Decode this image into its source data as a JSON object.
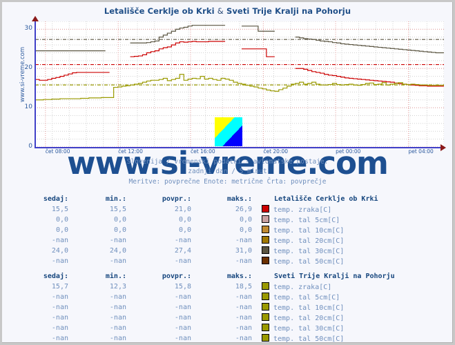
{
  "page": {
    "side_text": "www.si-vreme.com",
    "watermark": "www.si-vreme.com",
    "title": "Letališče Cerklje ob Krki & Sveti Trije Kralji na Pohorju",
    "title_part1": "Letališče Cerklje ob Krki",
    "title_amp": "&",
    "title_part2": "Sveti Trije Kralji na Pohorju",
    "subtitle1": "Slovenija / vremenski podatki - avtomatske postaje.",
    "subtitle2": "zadnji dan / 5 minut",
    "subtitle3": "Meritve: povprečne  Enote: metrične  Črta: povprečje"
  },
  "colors": {
    "accent": "#1f4e87",
    "axis": "#4040c8",
    "arrow": "#8b1a1a",
    "grid_major": "#e8a0a0",
    "grid_minor": "#d8d8d8",
    "label": "#2c5a9e",
    "value": "#6f8fbd",
    "header": "#16467e",
    "background": "#f6f7fc",
    "plot_bg": "#ffffff"
  },
  "chart_data": {
    "type": "line",
    "title": "Letališče Cerklje ob Krki & Sveti Trije Kralji na Pohorju",
    "xlabel": "",
    "ylabel": "",
    "ylim": [
      0,
      32
    ],
    "yticks": [
      0,
      10,
      20,
      30
    ],
    "ytick_labels": [
      "0",
      "10",
      "20",
      "30"
    ],
    "xticks": [
      "čet 08:00",
      "čet 12:00",
      "čet 16:00",
      "čet 20:00",
      "pet 00:00",
      "pet 04:00"
    ],
    "xtick_positions_pct": [
      2.5,
      20.3,
      38.0,
      55.8,
      73.5,
      91.3
    ],
    "grid": true,
    "legend_position": "below-table",
    "averages": [
      {
        "name": "Cerklje temp. tal 30cm[C]",
        "value": 27.4,
        "color": "#5a5440",
        "style": "dash-dot"
      },
      {
        "name": "Cerklje temp. zraka[C]",
        "value": 21.0,
        "color": "#cc0000",
        "style": "dash-dot"
      },
      {
        "name": "Sv. Trije Kralji temp. zraka[C]",
        "value": 15.8,
        "color": "#9a9a00",
        "style": "dash-dot"
      }
    ],
    "series": [
      {
        "name": "Letališče Cerklje ob Krki - temp. zraka[C]",
        "color": "#cc0000",
        "x": [
          0,
          1,
          2,
          3,
          4,
          5,
          6,
          7,
          8,
          9,
          10,
          11,
          12,
          13,
          14,
          15,
          16,
          17,
          18,
          19,
          20,
          21,
          22,
          23,
          24,
          25,
          26,
          27,
          28,
          29,
          30,
          31,
          32,
          33,
          34,
          35,
          36,
          37,
          38,
          39,
          40,
          41,
          42,
          43,
          44,
          45,
          46,
          47,
          48,
          49,
          50,
          51,
          52,
          53,
          54,
          55,
          56,
          57,
          58,
          59,
          60,
          61,
          62,
          63,
          64,
          65,
          66,
          67,
          68,
          69,
          70,
          71,
          72,
          73,
          74,
          75,
          76,
          77,
          78,
          79,
          80,
          81,
          82,
          83,
          84,
          85,
          86,
          87,
          88,
          89,
          90,
          91,
          92,
          93,
          94,
          95,
          96,
          97,
          98,
          99
        ],
        "y": [
          17.2,
          17.0,
          17.0,
          17.2,
          17.5,
          17.7,
          18.0,
          18.3,
          18.6,
          18.9,
          19.0,
          19.0,
          19.0,
          19.0,
          19.0,
          19.0,
          19.0,
          19.0,
          19.0,
          null,
          null,
          null,
          null,
          23.0,
          23.1,
          23.2,
          23.5,
          24.0,
          24.3,
          24.5,
          25.0,
          25.3,
          25.5,
          26.0,
          26.5,
          26.8,
          26.7,
          26.8,
          26.9,
          26.8,
          26.8,
          26.8,
          26.9,
          26.9,
          26.9,
          26.9,
          26.9,
          null,
          null,
          null,
          25.0,
          25.0,
          25.0,
          25.0,
          25.0,
          25.0,
          23.0,
          23.0,
          23.0,
          null,
          null,
          null,
          null,
          20.0,
          20.0,
          19.8,
          19.5,
          19.2,
          19.0,
          18.8,
          18.5,
          18.3,
          18.2,
          18.0,
          17.8,
          17.6,
          17.5,
          17.4,
          17.3,
          17.2,
          17.1,
          17.0,
          16.9,
          16.8,
          16.7,
          16.6,
          16.5,
          16.3,
          16.1,
          16.0,
          15.9,
          15.8,
          15.7,
          15.6,
          15.6,
          15.5,
          15.5,
          15.5,
          15.5,
          15.5
        ]
      },
      {
        "name": "Letališče Cerklje ob Krki - temp. tal 30cm[C]",
        "color": "#5a5440",
        "x": [
          0,
          1,
          2,
          3,
          4,
          5,
          6,
          7,
          8,
          9,
          10,
          11,
          12,
          13,
          14,
          15,
          16,
          17,
          18,
          19,
          20,
          21,
          22,
          23,
          24,
          25,
          26,
          27,
          28,
          29,
          30,
          31,
          32,
          33,
          34,
          35,
          36,
          37,
          38,
          39,
          40,
          41,
          42,
          43,
          44,
          45,
          46,
          47,
          48,
          49,
          50,
          51,
          52,
          53,
          54,
          55,
          56,
          57,
          58,
          59,
          60,
          61,
          62,
          63,
          64,
          65,
          66,
          67,
          68,
          69,
          70,
          71,
          72,
          73,
          74,
          75,
          76,
          77,
          78,
          79,
          80,
          81,
          82,
          83,
          84,
          85,
          86,
          87,
          88,
          89,
          90,
          91,
          92,
          93,
          94,
          95,
          96,
          97,
          98,
          99
        ],
        "y": [
          24.5,
          24.5,
          24.5,
          24.5,
          24.5,
          24.5,
          24.5,
          24.5,
          24.5,
          24.5,
          24.5,
          24.5,
          24.5,
          24.5,
          24.5,
          24.5,
          24.5,
          24.5,
          null,
          null,
          null,
          null,
          null,
          26.5,
          26.5,
          26.5,
          26.5,
          26.6,
          26.8,
          27.0,
          28.0,
          28.5,
          29.0,
          29.5,
          30.0,
          30.3,
          30.5,
          30.8,
          31.0,
          31.0,
          31.0,
          31.0,
          31.0,
          31.0,
          31.0,
          31.0,
          31.0,
          null,
          null,
          null,
          30.8,
          30.8,
          30.8,
          30.8,
          29.5,
          29.5,
          29.5,
          29.5,
          29.5,
          null,
          null,
          null,
          null,
          28.0,
          27.8,
          27.6,
          27.5,
          27.4,
          27.2,
          27.0,
          26.9,
          26.8,
          26.6,
          26.5,
          26.3,
          26.2,
          26.1,
          26.0,
          25.9,
          25.8,
          25.7,
          25.6,
          25.5,
          25.4,
          25.3,
          25.2,
          25.1,
          25.0,
          24.9,
          24.8,
          24.7,
          24.6,
          24.5,
          24.4,
          24.3,
          24.2,
          24.1,
          24.0,
          24.0,
          23.9
        ]
      },
      {
        "name": "Sveti Trije Kralji na Pohorju - temp. zraka[C]",
        "color": "#9a9a00",
        "x": [
          0,
          1,
          2,
          3,
          4,
          5,
          6,
          7,
          8,
          9,
          10,
          11,
          12,
          13,
          14,
          15,
          16,
          17,
          18,
          19,
          20,
          21,
          22,
          23,
          24,
          25,
          26,
          27,
          28,
          29,
          30,
          31,
          32,
          33,
          34,
          35,
          36,
          37,
          38,
          39,
          40,
          41,
          42,
          43,
          44,
          45,
          46,
          47,
          48,
          49,
          50,
          51,
          52,
          53,
          54,
          55,
          56,
          57,
          58,
          59,
          60,
          61,
          62,
          63,
          64,
          65,
          66,
          67,
          68,
          69,
          70,
          71,
          72,
          73,
          74,
          75,
          76,
          77,
          78,
          79,
          80,
          81,
          82,
          83,
          84,
          85,
          86,
          87,
          88,
          89,
          90,
          91,
          92,
          93,
          94,
          95,
          96,
          97,
          98,
          99
        ],
        "y": [
          12.0,
          12.0,
          12.1,
          12.1,
          12.2,
          12.2,
          12.3,
          12.3,
          12.3,
          12.3,
          12.3,
          12.4,
          12.4,
          12.5,
          12.5,
          12.5,
          12.6,
          12.6,
          12.6,
          15.2,
          15.3,
          15.5,
          15.6,
          15.8,
          16.0,
          16.2,
          16.5,
          16.8,
          17.0,
          17.0,
          17.2,
          17.5,
          16.9,
          17.2,
          17.5,
          18.5,
          17.0,
          17.3,
          17.5,
          17.4,
          18.0,
          17.3,
          17.5,
          17.2,
          17.0,
          17.5,
          17.3,
          17.0,
          16.5,
          16.2,
          16.0,
          15.7,
          15.5,
          15.3,
          15.0,
          14.8,
          14.5,
          14.3,
          14.2,
          14.6,
          15.0,
          15.5,
          16.0,
          16.2,
          16.5,
          16.0,
          16.2,
          16.5,
          16.0,
          15.8,
          15.8,
          15.9,
          16.2,
          15.9,
          15.8,
          15.9,
          16.0,
          15.8,
          15.7,
          15.9,
          16.2,
          16.3,
          15.9,
          16.0,
          16.4,
          15.8,
          16.0,
          16.2,
          16.4,
          16.0,
          15.9,
          16.0,
          15.9,
          15.8,
          15.8,
          15.7,
          15.7,
          15.7,
          15.7,
          15.7
        ]
      }
    ]
  },
  "table1": {
    "headers": {
      "sedaj": "sedaj:",
      "min": "min.:",
      "povpr": "povpr.:",
      "maks": "maks.:",
      "name": "Letališče Cerklje ob Krki"
    },
    "rows": [
      {
        "sedaj": "15,5",
        "min": "15,5",
        "povpr": "21,0",
        "maks": "26,9",
        "color": "#cc0000",
        "label": "temp. zraka[C]"
      },
      {
        "sedaj": "0,0",
        "min": "0,0",
        "povpr": "0,0",
        "maks": "0,0",
        "color": "#c8a0a0",
        "label": "temp. tal  5cm[C]"
      },
      {
        "sedaj": "0,0",
        "min": "0,0",
        "povpr": "0,0",
        "maks": "0,0",
        "color": "#c08a30",
        "label": "temp. tal 10cm[C]"
      },
      {
        "sedaj": "-nan",
        "min": "-nan",
        "povpr": "-nan",
        "maks": "-nan",
        "color": "#a07800",
        "label": "temp. tal 20cm[C]"
      },
      {
        "sedaj": "24,0",
        "min": "24,0",
        "povpr": "27,4",
        "maks": "31,0",
        "color": "#5a5440",
        "label": "temp. tal 30cm[C]"
      },
      {
        "sedaj": "-nan",
        "min": "-nan",
        "povpr": "-nan",
        "maks": "-nan",
        "color": "#6b3000",
        "label": "temp. tal 50cm[C]"
      }
    ]
  },
  "table2": {
    "headers": {
      "sedaj": "sedaj:",
      "min": "min.:",
      "povpr": "povpr.:",
      "maks": "maks.:",
      "name": "Sveti Trije Kralji na Pohorju"
    },
    "rows": [
      {
        "sedaj": "15,7",
        "min": "12,3",
        "povpr": "15,8",
        "maks": "18,5",
        "color": "#9a9a00",
        "label": "temp. zraka[C]"
      },
      {
        "sedaj": "-nan",
        "min": "-nan",
        "povpr": "-nan",
        "maks": "-nan",
        "color": "#9a9a00",
        "label": "temp. tal  5cm[C]"
      },
      {
        "sedaj": "-nan",
        "min": "-nan",
        "povpr": "-nan",
        "maks": "-nan",
        "color": "#9a9a00",
        "label": "temp. tal 10cm[C]"
      },
      {
        "sedaj": "-nan",
        "min": "-nan",
        "povpr": "-nan",
        "maks": "-nan",
        "color": "#9a9a00",
        "label": "temp. tal 20cm[C]"
      },
      {
        "sedaj": "-nan",
        "min": "-nan",
        "povpr": "-nan",
        "maks": "-nan",
        "color": "#9a9a00",
        "label": "temp. tal 30cm[C]"
      },
      {
        "sedaj": "-nan",
        "min": "-nan",
        "povpr": "-nan",
        "maks": "-nan",
        "color": "#9a9a00",
        "label": "temp. tal 50cm[C]"
      }
    ]
  }
}
